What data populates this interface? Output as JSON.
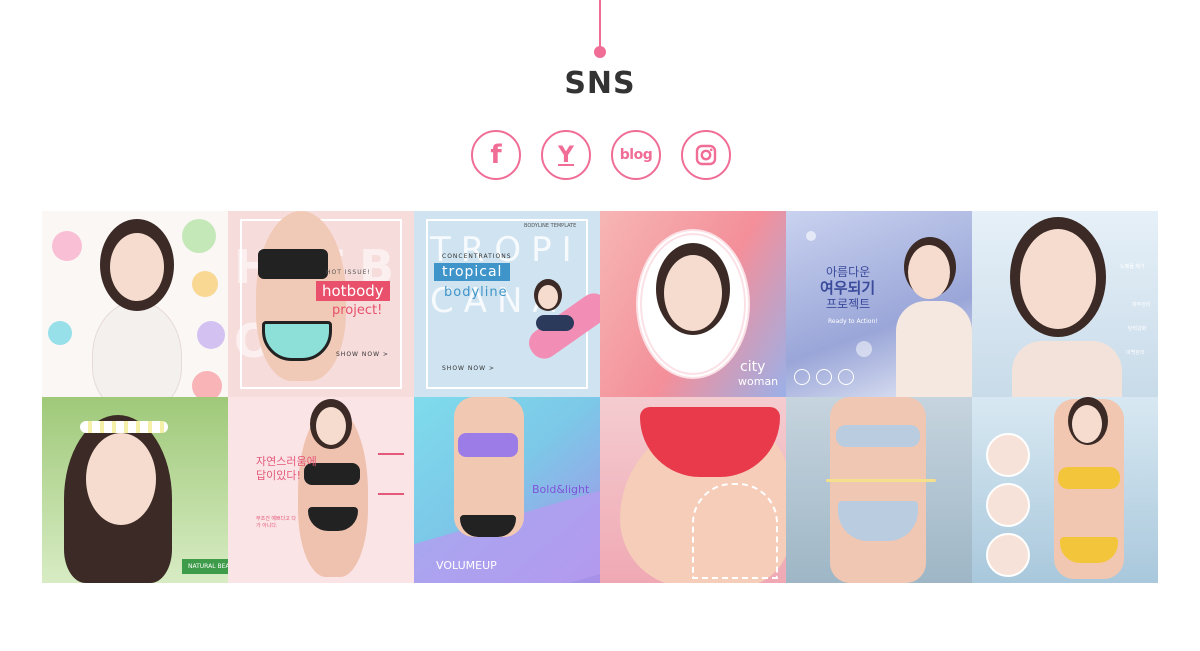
{
  "header": {
    "title": "SNS"
  },
  "colors": {
    "accent": "#f06d96",
    "title": "#333333"
  },
  "social": [
    {
      "name": "facebook",
      "label": "f",
      "icon": "facebook-icon"
    },
    {
      "name": "yellowid",
      "label": "Y",
      "icon": "yellow-id-icon"
    },
    {
      "name": "blog",
      "label": "blog",
      "icon": "blog-icon"
    },
    {
      "name": "instagram",
      "label": "",
      "icon": "instagram-icon"
    }
  ],
  "gallery": {
    "t2": {
      "tag": "HOT ISSUE!",
      "title": "hotbody",
      "sub": "project!",
      "cta": "SHOW NOW >",
      "bg_text": "HOT BODY"
    },
    "t3": {
      "tag": "CONCENTRATIONS",
      "title": "tropical",
      "sub": "bodyline",
      "cta": "SHOW NOW >",
      "bg_text": "TROPICANA",
      "corner": "BODYLINE TEMPLATE"
    },
    "t4": {
      "title": "city",
      "sub": "woman"
    },
    "t5": {
      "line1": "아름다운",
      "line2": "여우되기",
      "line3": "프로젝트",
      "cta": "Ready to Action!"
    },
    "t6": {
      "labels": [
        "노폐물 제거",
        "피부관리",
        "탄력강화",
        "미백관리"
      ]
    },
    "t7": {
      "badge": "NATURAL BEAUTY"
    },
    "t8": {
      "line1": "자연스러움에",
      "line2": "답이있다!",
      "small": "무조건 예쁘다고 다가 아니다."
    },
    "t9": {
      "title": "Bold&light",
      "sub": "VOLUMEUP"
    }
  }
}
